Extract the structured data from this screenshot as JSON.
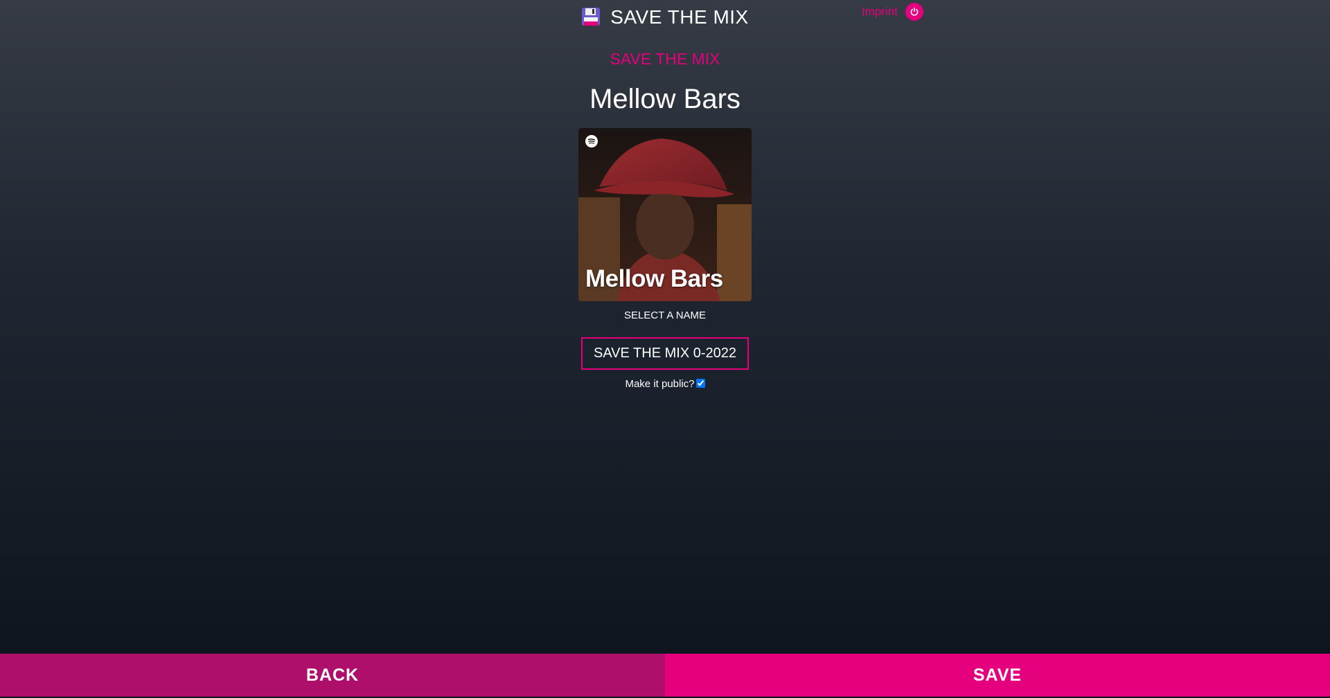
{
  "header": {
    "title": "SAVE THE MIX",
    "title_icon": "floppy-disk-icon",
    "imprint_label": "Imprint",
    "power_icon": "power-icon"
  },
  "main": {
    "heading": "SAVE THE MIX",
    "playlist_name": "Mellow Bars",
    "cover": {
      "title": "Mellow Bars",
      "badge_icon": "spotify-icon"
    },
    "select_label": "SELECT A NAME",
    "name_input_value": "SAVE THE MIX 0-2022",
    "public_label": "Make it public?",
    "public_checked": true
  },
  "footer": {
    "back_label": "BACK",
    "save_label": "SAVE"
  },
  "colors": {
    "accent": "#e5007d",
    "accent_dark": "#ae0f6b",
    "background_top": "#363b45",
    "background_bottom": "#0c131c"
  }
}
